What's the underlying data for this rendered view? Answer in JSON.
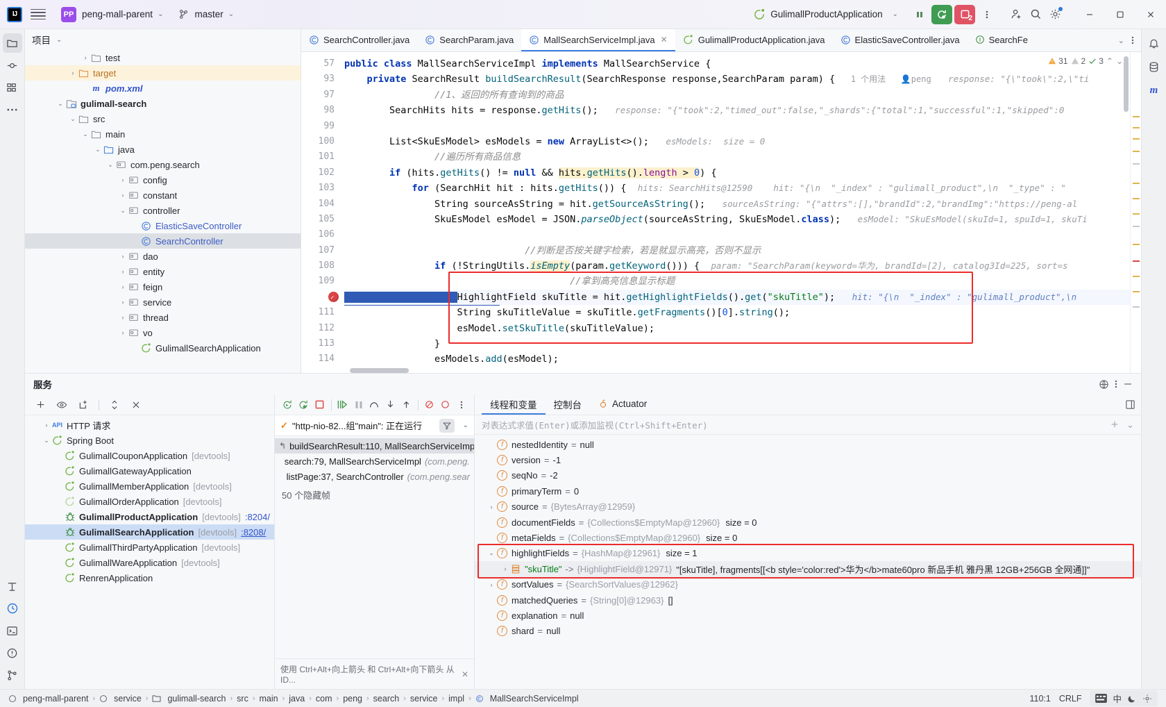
{
  "titlebar": {
    "logo": "IJ",
    "project": "peng-mall-parent",
    "branch": "master",
    "run_config": "GulimallProductApplication",
    "icons": [
      "pause-icon",
      "rerun-debug-icon",
      "stop-service-icon",
      "more-vertical-icon",
      "add-user-icon",
      "search-icon",
      "settings-icon"
    ],
    "debug_count": "2",
    "window": {
      "minimize": "—",
      "maximize": "▢",
      "close": "✕"
    }
  },
  "project_panel": {
    "header": "项目",
    "tree": [
      {
        "indent": 4,
        "arrow": "",
        "icon": "folder-gray",
        "label": "…",
        "style": "clipped"
      },
      {
        "indent": 4,
        "arrow": "›",
        "icon": "folder-gray",
        "label": "test",
        "style": ""
      },
      {
        "indent": 3,
        "arrow": "›",
        "icon": "folder-orange",
        "label": "target",
        "style": "orange",
        "row": "hl"
      },
      {
        "indent": 4,
        "arrow": "",
        "icon": "maven",
        "label": "pom.xml",
        "style": "mvn"
      },
      {
        "indent": 2,
        "arrow": "⌄",
        "icon": "module",
        "label": "gulimall-search",
        "style": "bold"
      },
      {
        "indent": 3,
        "arrow": "⌄",
        "icon": "folder-gray",
        "label": "src",
        "style": ""
      },
      {
        "indent": 4,
        "arrow": "⌄",
        "icon": "folder-gray",
        "label": "main",
        "style": ""
      },
      {
        "indent": 5,
        "arrow": "⌄",
        "icon": "folder-blue",
        "label": "java",
        "style": ""
      },
      {
        "indent": 6,
        "arrow": "⌄",
        "icon": "package",
        "label": "com.peng.search",
        "style": ""
      },
      {
        "indent": 7,
        "arrow": "›",
        "icon": "package",
        "label": "config",
        "style": ""
      },
      {
        "indent": 7,
        "arrow": "›",
        "icon": "package",
        "label": "constant",
        "style": ""
      },
      {
        "indent": 7,
        "arrow": "⌄",
        "icon": "package",
        "label": "controller",
        "style": ""
      },
      {
        "indent": 8,
        "arrow": "",
        "icon": "class",
        "label": "ElasticSaveController",
        "style": "blue"
      },
      {
        "indent": 8,
        "arrow": "",
        "icon": "class",
        "label": "SearchController",
        "style": "blue",
        "row": "sel"
      },
      {
        "indent": 7,
        "arrow": "›",
        "icon": "package",
        "label": "dao",
        "style": ""
      },
      {
        "indent": 7,
        "arrow": "›",
        "icon": "package",
        "label": "entity",
        "style": ""
      },
      {
        "indent": 7,
        "arrow": "›",
        "icon": "package",
        "label": "feign",
        "style": ""
      },
      {
        "indent": 7,
        "arrow": "›",
        "icon": "package",
        "label": "service",
        "style": ""
      },
      {
        "indent": 7,
        "arrow": "›",
        "icon": "package",
        "label": "thread",
        "style": ""
      },
      {
        "indent": 7,
        "arrow": "›",
        "icon": "package",
        "label": "vo",
        "style": ""
      },
      {
        "indent": 8,
        "arrow": "",
        "icon": "spring",
        "label": "GulimallSearchApplication",
        "style": ""
      }
    ]
  },
  "editor": {
    "tabs": [
      {
        "label": "SearchController.java",
        "icon": "class-icon",
        "active": false,
        "closable": false
      },
      {
        "label": "SearchParam.java",
        "icon": "class-icon",
        "active": false,
        "closable": false
      },
      {
        "label": "MallSearchServiceImpl.java",
        "icon": "class-icon",
        "active": true,
        "closable": true
      },
      {
        "label": "GulimallProductApplication.java",
        "icon": "spring-icon",
        "active": false,
        "closable": false
      },
      {
        "label": "ElasticSaveController.java",
        "icon": "class-icon",
        "active": false,
        "closable": false
      },
      {
        "label": "SearchFe",
        "icon": "interface-icon",
        "active": false,
        "closable": false
      }
    ],
    "inspections": {
      "warnings": "31",
      "weak_warnings": "2",
      "checks": "3"
    },
    "lines": [
      {
        "num": "57",
        "kind": "header1"
      },
      {
        "num": "93",
        "kind": "header2"
      },
      {
        "num": "97",
        "kind": "c97"
      },
      {
        "num": "98",
        "kind": "c98"
      },
      {
        "num": "99",
        "kind": "blank"
      },
      {
        "num": "100",
        "kind": "c100"
      },
      {
        "num": "101",
        "kind": "c101"
      },
      {
        "num": "102",
        "kind": "c102"
      },
      {
        "num": "103",
        "kind": "c103"
      },
      {
        "num": "104",
        "kind": "c104"
      },
      {
        "num": "105",
        "kind": "c105"
      },
      {
        "num": "106",
        "kind": "blank"
      },
      {
        "num": "107",
        "kind": "c107"
      },
      {
        "num": "108",
        "kind": "c108"
      },
      {
        "num": "109",
        "kind": "c109"
      },
      {
        "num": "110",
        "kind": "c110",
        "breakpoint": true
      },
      {
        "num": "111",
        "kind": "c111"
      },
      {
        "num": "112",
        "kind": "c112"
      },
      {
        "num": "113",
        "kind": "c113"
      },
      {
        "num": "114",
        "kind": "c114"
      }
    ],
    "code": {
      "l57": "public class MallSearchServiceImpl implements MallSearchService {",
      "l93": "    private SearchResult buildSearchResult(SearchResponse response,SearchParam param) {",
      "l93_usage": "1 个用法",
      "l93_author": "peng",
      "l93_hint": "response: \"{\\\"took\\\":2,\\\"ti",
      "l97": "        //1、返回的所有查询到的商品",
      "l98": "        SearchHits hits = response.getHits();",
      "l98_hint": "response: \"{\"took\":2,\"timed_out\":false,\"_shards\":{\"total\":1,\"successful\":1,\"skipped\":0",
      "l100": "        List<SkuEsModel> esModels = new ArrayList<>();",
      "l100_hint": "esModels:  size = 0",
      "l101": "        //遍历所有商品信息",
      "l102a": "        if (hits.getHits() != null && ",
      "l102b": "hits.getHits().length > 0",
      "l102c": ") {",
      "l103": "            for (SearchHit hit : hits.getHits()) {",
      "l103_hint": "hits: SearchHits@12590     hit: \"{\\n  \"_index\" : \"gulimall_product\",\\n  \"_type\" : \"",
      "l104": "                String sourceAsString = hit.getSourceAsString();",
      "l104_hint": "sourceAsString: \"{\"attrs\":[],\"brandId\":2,\"brandImg\":\"https://peng-al",
      "l105": "                SkuEsModel esModel = JSON.parseObject(sourceAsString, SkuEsModel.class);",
      "l105_hint": "esModel: \"SkuEsModel(skuId=1, spuId=1, skuTi",
      "l107": "                //判断是否按关键字检索，若是就显示高亮，否则不显示",
      "l108a": "                if (!StringUtils.",
      "l108b": "isEmpty",
      "l108c": "(param.getKeyword())) {",
      "l108_hint": "param: \"SearchParam(keyword=华为, brandId=[2], catalog3Id=225, sort=s",
      "l109": "                    //拿到高亮信息显示标题",
      "l110": "                    HighlightField skuTitle = hit.getHighlightFields().get(\"skuTitle\");",
      "l110_hint": "hit: \"{\\n  \"_index\" : \"gulimall_product\",\\n",
      "l111": "                    String skuTitleValue = skuTitle.getFragments()[0].string();",
      "l112": "                    esModel.setSkuTitle(skuTitleValue);",
      "l113": "                }",
      "l114": "                esModels.add(esModel);"
    }
  },
  "services": {
    "title": "服务",
    "toolbar_icons": [
      "add-icon",
      "eye-icon",
      "new-tab-icon",
      "expand-collapse-icon",
      "close-all-icon"
    ],
    "tree": [
      {
        "indent": 1,
        "arrow": "›",
        "icon": "http",
        "label": "HTTP 请求",
        "bold": false,
        "tag": "",
        "port": ""
      },
      {
        "indent": 1,
        "arrow": "⌄",
        "icon": "spring",
        "label": "Spring Boot",
        "bold": false,
        "tag": "",
        "port": ""
      },
      {
        "indent": 2,
        "arrow": "",
        "icon": "spring",
        "label": "GulimallCouponApplication",
        "bold": false,
        "tag": "[devtools]",
        "port": ""
      },
      {
        "indent": 2,
        "arrow": "",
        "icon": "spring",
        "label": "GulimallGatewayApplication",
        "bold": false,
        "tag": "",
        "port": ""
      },
      {
        "indent": 2,
        "arrow": "",
        "icon": "spring",
        "label": "GulimallMemberApplication",
        "bold": false,
        "tag": "[devtools]",
        "port": ""
      },
      {
        "indent": 2,
        "arrow": "",
        "icon": "spring-dim",
        "label": "GulimallOrderApplication",
        "bold": false,
        "tag": "[devtools]",
        "port": ""
      },
      {
        "indent": 2,
        "arrow": "",
        "icon": "bug",
        "label": "GulimallProductApplication",
        "bold": true,
        "tag": "[devtools]",
        "port": ":8204/"
      },
      {
        "indent": 2,
        "arrow": "",
        "icon": "bug",
        "label": "GulimallSearchApplication",
        "bold": true,
        "tag": "[devtools]",
        "port": ":8208/",
        "row": "sel"
      },
      {
        "indent": 2,
        "arrow": "",
        "icon": "spring",
        "label": "GulimallThirdPartyApplication",
        "bold": false,
        "tag": "[devtools]",
        "port": ""
      },
      {
        "indent": 2,
        "arrow": "",
        "icon": "spring",
        "label": "GulimallWareApplication",
        "bold": false,
        "tag": "[devtools]",
        "port": ""
      },
      {
        "indent": 2,
        "arrow": "",
        "icon": "spring",
        "label": "RenrenApplication",
        "bold": false,
        "tag": "",
        "port": ""
      }
    ]
  },
  "debugger": {
    "toolbar_icons": [
      "rerun-icon",
      "rerun-debug-icon",
      "stop-icon",
      "resume-icon",
      "pause-icon",
      "step-over-icon",
      "step-into-icon",
      "step-out-icon",
      "mute-breakpoints-icon",
      "view-breakpoints-icon",
      "more-icon"
    ],
    "thread": "\"http-nio-82...组\"main\": 正在运行",
    "frames": [
      {
        "label": "buildSearchResult:110, MallSearchServiceImp",
        "pkg": "",
        "sel": true
      },
      {
        "label": "search:79, MallSearchServiceImpl",
        "pkg": "(com.peng.",
        "sel": false
      },
      {
        "label": "listPage:37, SearchController",
        "pkg": "(com.peng.sear",
        "sel": false
      }
    ],
    "hidden_frames": "50 个隐藏帧",
    "hint": "使用 Ctrl+Alt+向上箭头 和 Ctrl+Alt+向下箭头 从 ID..."
  },
  "variables": {
    "tabs": [
      {
        "label": "线程和变量",
        "active": true,
        "icon": ""
      },
      {
        "label": "控制台",
        "active": false,
        "icon": ""
      },
      {
        "label": "Actuator",
        "active": false,
        "icon": "actuator-icon"
      }
    ],
    "eval_placeholder": "对表达式求值(Enter)或添加监视(Ctrl+Shift+Enter)",
    "rows": [
      {
        "arrow": "",
        "icon": "field-static",
        "name": "nestedIdentity",
        "eq": "=",
        "value": "null",
        "ref": "",
        "size": ""
      },
      {
        "arrow": "",
        "icon": "field",
        "name": "version",
        "eq": "=",
        "value": "-1",
        "ref": "",
        "size": ""
      },
      {
        "arrow": "",
        "icon": "field",
        "name": "seqNo",
        "eq": "=",
        "value": "-2",
        "ref": "",
        "size": ""
      },
      {
        "arrow": "",
        "icon": "field",
        "name": "primaryTerm",
        "eq": "=",
        "value": "0",
        "ref": "",
        "size": ""
      },
      {
        "arrow": "›",
        "icon": "field",
        "name": "source",
        "eq": "=",
        "value": "",
        "ref": "{BytesArray@12959}",
        "size": ""
      },
      {
        "arrow": "",
        "icon": "field",
        "name": "documentFields",
        "eq": "=",
        "value": "",
        "ref": "{Collections$EmptyMap@12960}",
        "size": "size = 0"
      },
      {
        "arrow": "",
        "icon": "field-static",
        "name": "metaFields",
        "eq": "=",
        "value": "",
        "ref": "{Collections$EmptyMap@12960}",
        "size": "size = 0"
      },
      {
        "arrow": "⌄",
        "icon": "field",
        "name": "highlightFields",
        "eq": "=",
        "value": "",
        "ref": "{HashMap@12961}",
        "size": "size = 1",
        "boxed": true
      },
      {
        "arrow": "›",
        "icon": "map-entry",
        "name": "\"skuTitle\"",
        "eq": "->",
        "value": "\"[skuTitle], fragments[[<b style='color:red'>华为</b>mate60pro 新品手机  雅丹黑 12GB+256GB 全网通]]\"",
        "ref": "{HighlightField@12971}",
        "size": "",
        "boxed": true,
        "strname": true
      },
      {
        "arrow": "›",
        "icon": "field",
        "name": "sortValues",
        "eq": "=",
        "value": "",
        "ref": "{SearchSortValues@12962}",
        "size": ""
      },
      {
        "arrow": "",
        "icon": "field",
        "name": "matchedQueries",
        "eq": "=",
        "value": "[]",
        "ref": "{String[0]@12963}",
        "size": ""
      },
      {
        "arrow": "",
        "icon": "field",
        "name": "explanation",
        "eq": "=",
        "value": "null",
        "ref": "",
        "size": ""
      },
      {
        "arrow": "",
        "icon": "field",
        "name": "shard",
        "eq": "=",
        "value": "null",
        "ref": "",
        "size": ""
      }
    ]
  },
  "statusbar": {
    "crumbs": [
      "peng-mall-parent",
      "service",
      "gulimall-search",
      "src",
      "main",
      "java",
      "com",
      "peng",
      "search",
      "service",
      "impl",
      "MallSearchServiceImpl"
    ],
    "position": "110:1",
    "line_sep": "CRLF",
    "ime_lang": "中"
  }
}
